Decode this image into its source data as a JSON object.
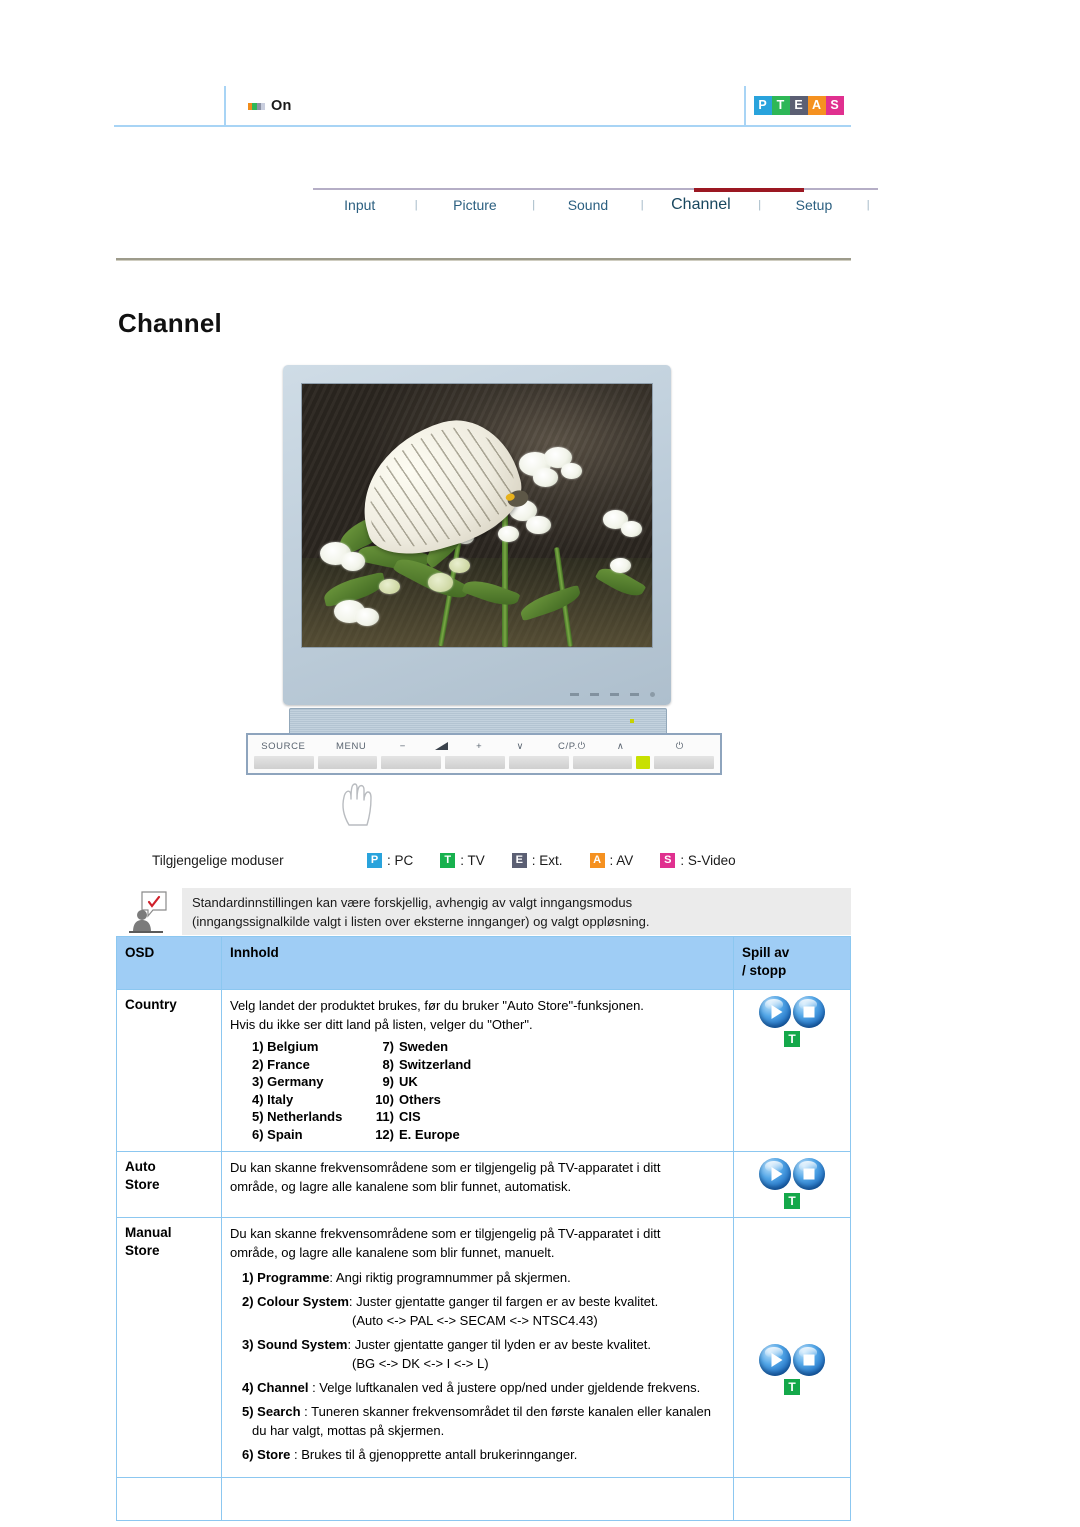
{
  "header": {
    "status_label": "On",
    "status_icon": "power-on-indicator-icon",
    "logo": {
      "letters": [
        "P",
        "T",
        "E",
        "A",
        "S"
      ],
      "colors": [
        "#29a3dc",
        "#2eb757",
        "#5b5f73",
        "#f59120",
        "#e0308f"
      ]
    }
  },
  "tabs": {
    "items": [
      {
        "label": "Input",
        "active": false
      },
      {
        "label": "Picture",
        "active": false
      },
      {
        "label": "Sound",
        "active": false
      },
      {
        "label": "Channel",
        "active": true
      },
      {
        "label": "Setup",
        "active": false
      }
    ],
    "separator": "|",
    "active_underline_color": "#9b1822",
    "rule_color": "#b5aec6"
  },
  "page": {
    "title": "Channel"
  },
  "monitor": {
    "controls": [
      "SOURCE",
      "MENU",
      "−",
      "volume-icon",
      "+",
      "∨",
      "C/P.⏻",
      "∧",
      "⏻"
    ],
    "led_color": "#c8e000"
  },
  "modes": {
    "label": "Tilgjengelige moduser",
    "items": [
      {
        "badge": "P",
        "text": ": PC",
        "color": "#29a3dc"
      },
      {
        "badge": "T",
        "text": ": TV",
        "color": "#18b14e"
      },
      {
        "badge": "E",
        "text": ": Ext.",
        "color": "#5b5f73"
      },
      {
        "badge": "A",
        "text": ": AV",
        "color": "#f59120"
      },
      {
        "badge": "S",
        "text": ": S-Video",
        "color": "#e0308f"
      }
    ]
  },
  "note": {
    "icon": "note-person-check-icon",
    "line1": "Standardinnstillingen kan være forskjellig, avhengig av valgt inngangsmodus",
    "line2": "(inngangssignalkilde valgt i listen over eksterne innganger) og valgt oppløsning."
  },
  "table": {
    "headers": {
      "osd": "OSD",
      "content": "Innhold",
      "play_line1": "Spill av",
      "play_line2": "/ stopp"
    },
    "rows": [
      {
        "osd": "Country",
        "intro1": "Velg landet der produktet brukes, før du bruker \"Auto Store\"-funksjonen.",
        "intro2": "Hvis du ikke ser ditt land på listen, velger du \"Other\".",
        "countries_left": [
          "1) Belgium",
          "2) France",
          "3) Germany",
          "4) Italy",
          "5) Netherlands",
          "6) Spain"
        ],
        "countries_right": [
          {
            "n": "7)",
            "name": "Sweden"
          },
          {
            "n": "8)",
            "name": "Switzerland"
          },
          {
            "n": "9)",
            "name": "UK"
          },
          {
            "n": "10)",
            "name": "Others"
          },
          {
            "n": "11)",
            "name": "CIS"
          },
          {
            "n": "12)",
            "name": "E. Europe"
          }
        ],
        "play": {
          "play": true,
          "stop": true,
          "badge": "T"
        }
      },
      {
        "osd_line1": "Auto",
        "osd_line2": "Store",
        "body1": "Du kan skanne frekvensområdene som er tilgjengelig på TV-apparatet i ditt",
        "body2": "område, og lagre alle kanalene som blir funnet, automatisk.",
        "play": {
          "play": true,
          "stop": true,
          "badge": "T"
        }
      },
      {
        "osd_line1": "Manual",
        "osd_line2": "Store",
        "body1": "Du kan skanne frekvensområdene som er tilgjengelig på TV-apparatet i ditt",
        "body2": "område, og lagre alle kanalene som blir funnet, manuelt.",
        "items": [
          {
            "num": "1)",
            "term": "Programme",
            "rest": ": Angi riktig programnummer på skjermen.",
            "sub": ""
          },
          {
            "num": "2)",
            "term": "Colour System",
            "rest": ": Juster gjentatte ganger til fargen er av beste kvalitet.",
            "sub": "(Auto <-> PAL <-> SECAM <-> NTSC4.43)"
          },
          {
            "num": "3)",
            "term": "Sound System",
            "rest": ": Juster gjentatte ganger til lyden er av beste kvalitet.",
            "sub": "(BG <-> DK <-> I <-> L)"
          },
          {
            "num": "4)",
            "term": "Channel",
            "rest": " : Velge luftkanalen ved å justere opp/ned under gjeldende frekvens.",
            "sub": ""
          },
          {
            "num": "5)",
            "term": "Search",
            "rest": " : Tuneren skanner frekvensområdet til den første kanalen eller kanalen du har valgt, mottas på skjermen.",
            "sub": ""
          },
          {
            "num": "6)",
            "term": "Store",
            "rest": " : Brukes til å gjenopprette antall brukerinnganger.",
            "sub": ""
          }
        ],
        "play": {
          "play": true,
          "stop": true,
          "badge": "T"
        }
      }
    ]
  }
}
